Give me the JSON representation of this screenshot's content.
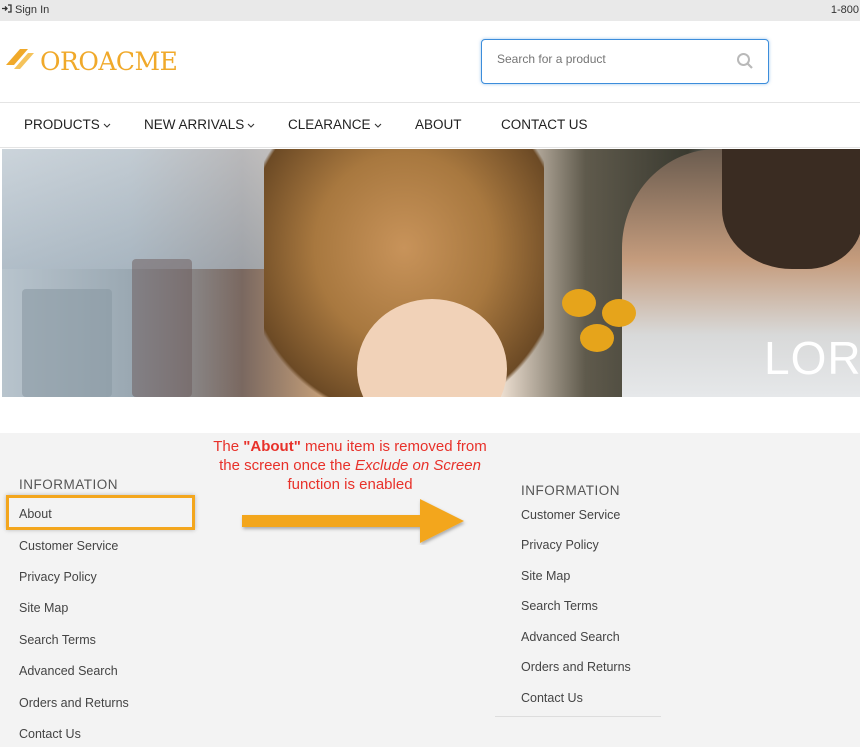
{
  "topbar": {
    "sign_in": "Sign In",
    "phone": "1-800"
  },
  "header": {
    "logo_oro": "ORO",
    "logo_acme": "ACME",
    "search_placeholder": "Search for a product"
  },
  "nav": {
    "items": [
      {
        "label": "PRODUCTS",
        "has_dropdown": true
      },
      {
        "label": "NEW ARRIVALS",
        "has_dropdown": true
      },
      {
        "label": "CLEARANCE",
        "has_dropdown": true
      },
      {
        "label": "ABOUT",
        "has_dropdown": false
      },
      {
        "label": "CONTACT US",
        "has_dropdown": false
      }
    ]
  },
  "hero": {
    "text": "LOR"
  },
  "annotation": {
    "line1_pre": "The ",
    "line1_bold": "\"About\"",
    "line1_post": " menu item  is removed from",
    "line2_pre": "the  screen once the ",
    "line2_italic": "Exclude on Screen",
    "line3": "function is enabled"
  },
  "footer_left": {
    "title": "INFORMATION",
    "links": [
      "About",
      "Customer Service",
      "Privacy Policy",
      "Site Map",
      "Search Terms",
      "Advanced Search",
      "Orders and Returns",
      "Contact Us"
    ]
  },
  "footer_right": {
    "title": "INFORMATION",
    "links": [
      "Customer Service",
      "Privacy Policy",
      "Site Map",
      "Search Terms",
      "Advanced Search",
      "Orders and Returns",
      "Contact Us"
    ]
  },
  "colors": {
    "accent": "#f0a92a",
    "annotation": "#e8312a",
    "highlight": "#f3a61d",
    "search_border": "#3c8ddb"
  }
}
